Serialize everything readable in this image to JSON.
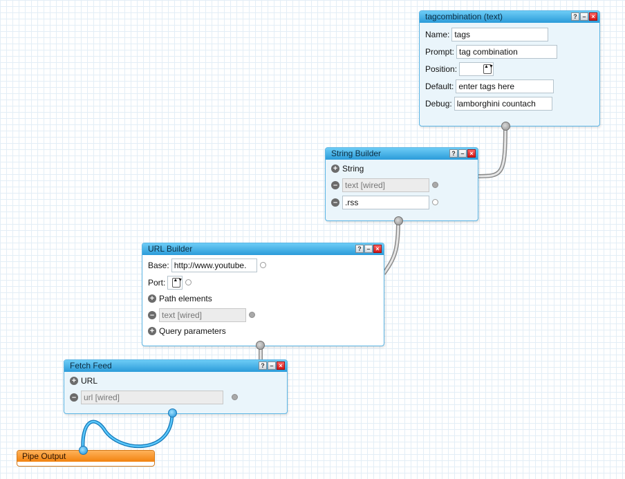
{
  "modules": {
    "tag": {
      "title": "tagcombination (text)",
      "name_label": "Name:",
      "name_value": "tags",
      "prompt_label": "Prompt:",
      "prompt_value": "tag combination",
      "position_label": "Position:",
      "position_value": "",
      "default_label": "Default:",
      "default_value": "enter tags here",
      "debug_label": "Debug:",
      "debug_value": "lamborghini countach"
    },
    "string_builder": {
      "title": "String Builder",
      "string_label": "String",
      "item1": "text [wired]",
      "item2": ".rss"
    },
    "url_builder": {
      "title": "URL Builder",
      "base_label": "Base:",
      "base_value": "http://www.youtube.",
      "port_label": "Port:",
      "port_value": "",
      "path_label": "Path elements",
      "path_item": "text [wired]",
      "query_label": "Query parameters"
    },
    "fetch_feed": {
      "title": "Fetch Feed",
      "url_label": "URL",
      "url_item": "url [wired]"
    },
    "pipe_output": {
      "title": "Pipe Output"
    }
  },
  "controls": {
    "help": "?",
    "minimize": "–",
    "close": "×"
  },
  "glyphs": {
    "add": "+",
    "remove": "–",
    "stepper": "▲▼"
  },
  "colors": {
    "module_title": "#2b9bd9",
    "output_title": "#f2820f",
    "wire": "#c8c8c8",
    "output_wire": "#1a8fd6"
  },
  "icons": [
    "help-icon",
    "minimize-icon",
    "close-icon",
    "add-icon",
    "remove-icon",
    "terminal-icon",
    "stepper-icon"
  ]
}
